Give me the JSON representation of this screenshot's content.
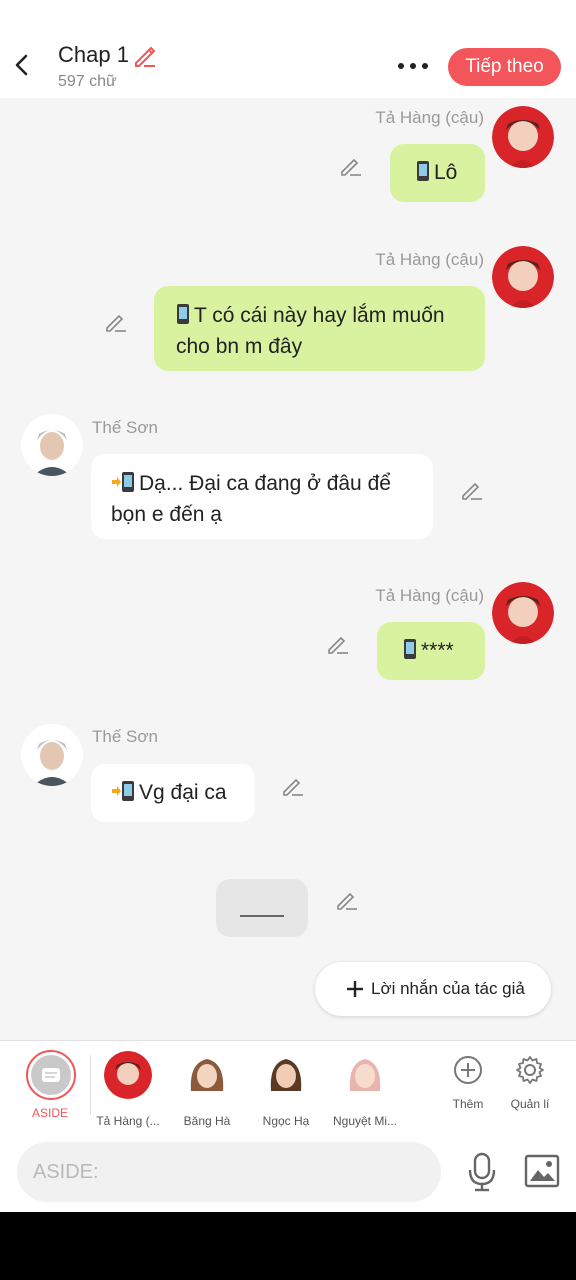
{
  "header": {
    "title": "Chap 1",
    "subtitle": "597 chữ",
    "next_label": "Tiếp theo"
  },
  "messages": [
    {
      "speaker": "Tả Hàng (cậu)",
      "side": "right",
      "text": "Lô"
    },
    {
      "speaker": "Tả Hàng (cậu)",
      "side": "right",
      "text": "T có cái này hay lắm muốn cho bn m đây"
    },
    {
      "speaker": "Thế Sơn",
      "side": "left",
      "text": "Dạ... Đại ca đang ở đâu để bọn e đến ạ"
    },
    {
      "speaker": "Tả Hàng (cậu)",
      "side": "right",
      "text": "****"
    },
    {
      "speaker": "Thế Sơn",
      "side": "left",
      "text": "Vg đại ca"
    }
  ],
  "author_note_label": "Lời nhắn của tác giả",
  "characters": [
    {
      "label": "ASIDE",
      "active": true
    },
    {
      "label": "Tả Hàng (..."
    },
    {
      "label": "Băng Hà"
    },
    {
      "label": "Ngọc Hạ"
    },
    {
      "label": "Nguyệt Mi..."
    }
  ],
  "tools": [
    {
      "label": "Thêm",
      "icon": "add-circle-icon"
    },
    {
      "label": "Quản lí",
      "icon": "gear-icon"
    }
  ],
  "input": {
    "placeholder": "ASIDE:",
    "value": ""
  },
  "colors": {
    "accent": "#f2555a",
    "bubble_right": "#d8f2a0",
    "bubble_left": "#ffffff",
    "background": "#f5f5f5"
  }
}
